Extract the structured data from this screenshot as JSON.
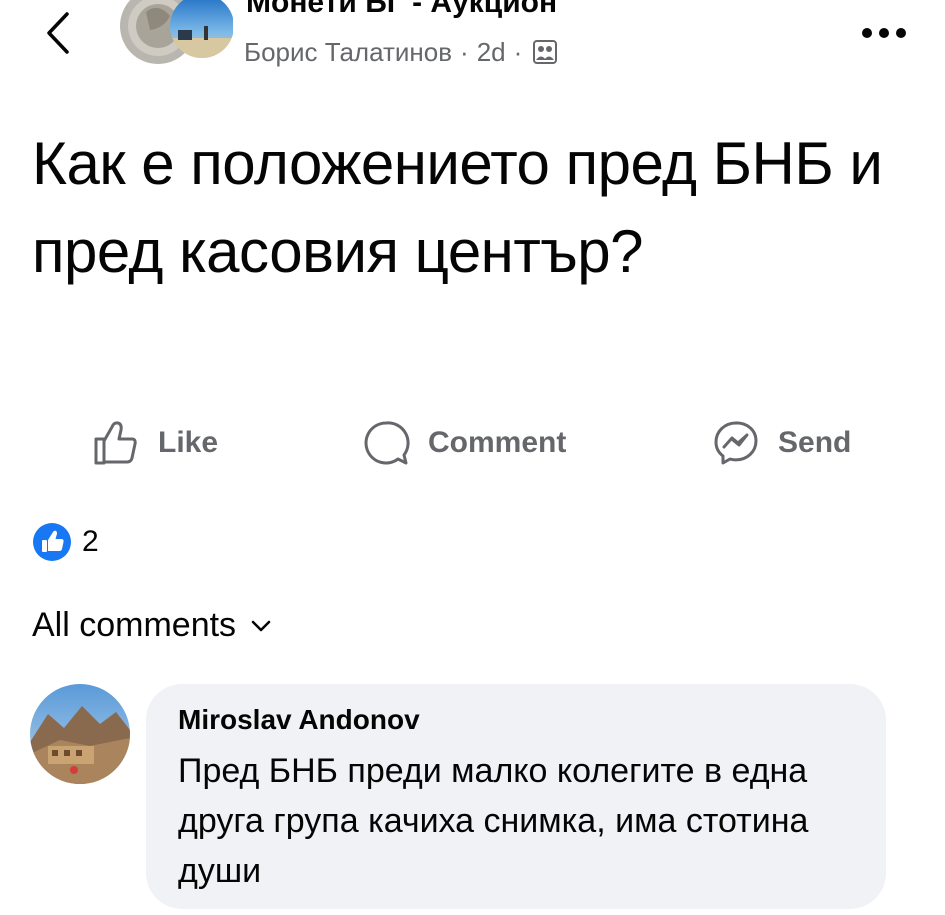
{
  "header": {
    "group_name": "Монети БГ - Аукцион",
    "author": "Борис Талатинов",
    "time": "2d",
    "separator": "·"
  },
  "post": {
    "text": "Как е положението пред БНБ и пред касовия център?"
  },
  "actions": {
    "like_label": "Like",
    "comment_label": "Comment",
    "send_label": "Send"
  },
  "reactions": {
    "count": "2"
  },
  "comments": {
    "filter_label": "All comments",
    "items": [
      {
        "author": "Miroslav Andonov",
        "text": "Пред БНБ преди малко колегите в една друга група качиха снимка, има стотина души"
      }
    ]
  },
  "colors": {
    "text_primary": "#050505",
    "text_secondary": "#65676b",
    "bubble_bg": "#f0f2f5",
    "like_blue": "#1877f2"
  },
  "icons": {
    "back": "chevron-left-icon",
    "more": "more-dots-icon",
    "group": "group-icon",
    "like": "thumbs-up-icon",
    "comment": "comment-bubble-icon",
    "send": "messenger-icon",
    "reaction": "like-reaction-icon",
    "filter": "chevron-down-icon"
  }
}
